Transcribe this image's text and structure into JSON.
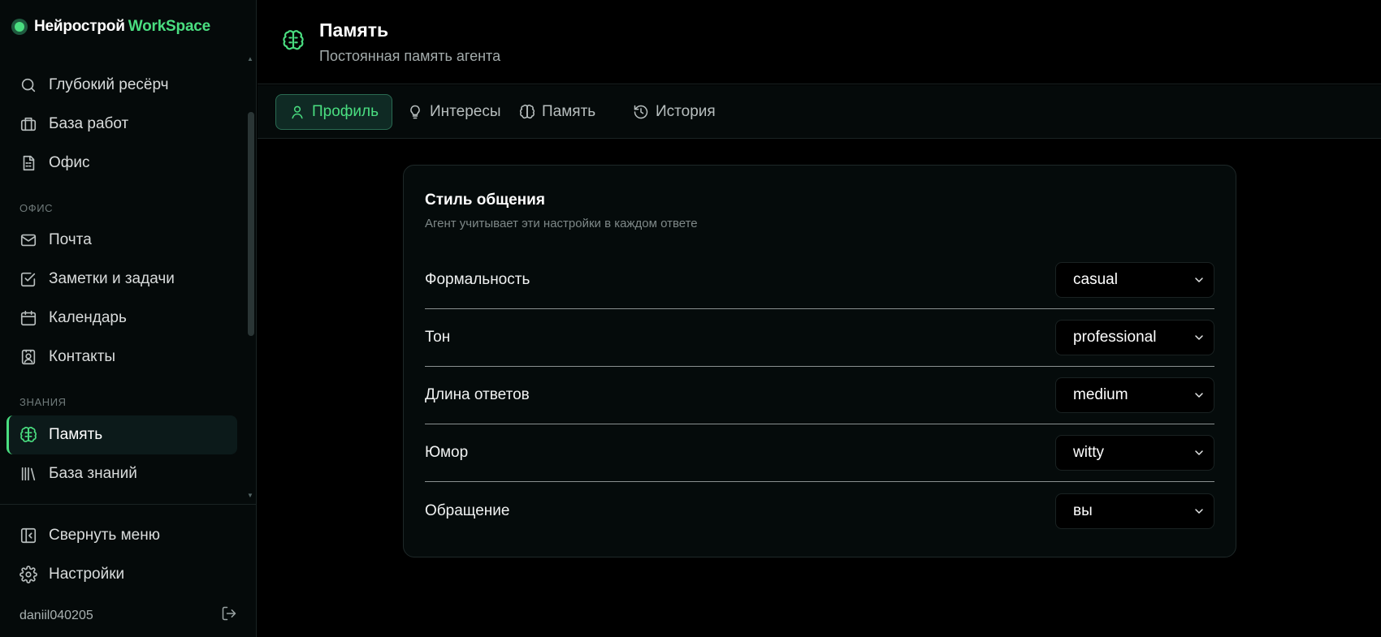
{
  "brand": {
    "name_part1": "Нейрострой",
    "name_part2": "WorkSpace",
    "accent": "#4ade80"
  },
  "sidebar": {
    "items_top": [
      {
        "label": "Глубокий ресёрч",
        "icon": "search-icon"
      },
      {
        "label": "База работ",
        "icon": "briefcase-icon"
      },
      {
        "label": "Офис",
        "icon": "document-icon"
      }
    ],
    "section_office": "ОФИС",
    "items_office": [
      {
        "label": "Почта",
        "icon": "mail-icon"
      },
      {
        "label": "Заметки и задачи",
        "icon": "checkbox-icon"
      },
      {
        "label": "Календарь",
        "icon": "calendar-icon"
      },
      {
        "label": "Контакты",
        "icon": "contact-icon"
      }
    ],
    "section_knowledge": "ЗНАНИЯ",
    "items_knowledge": [
      {
        "label": "Память",
        "icon": "brain-icon",
        "active": true
      },
      {
        "label": "База знаний",
        "icon": "library-icon"
      }
    ],
    "collapse_label": "Свернуть меню",
    "settings_label": "Настройки",
    "username": "daniil040205"
  },
  "header": {
    "title": "Память",
    "subtitle": "Постоянная память агента",
    "icon": "brain-icon"
  },
  "tabs": [
    {
      "label": "Профиль",
      "icon": "user-icon",
      "active": true
    },
    {
      "label": "Интересы",
      "icon": "lightbulb-icon"
    },
    {
      "label": "Память",
      "icon": "brain-icon"
    },
    {
      "label": "История",
      "icon": "history-icon"
    }
  ],
  "card": {
    "title": "Стиль общения",
    "subtitle": "Агент учитывает эти настройки в каждом ответе",
    "rows": [
      {
        "label": "Формальность",
        "value": "casual"
      },
      {
        "label": "Тон",
        "value": "professional"
      },
      {
        "label": "Длина ответов",
        "value": "medium"
      },
      {
        "label": "Юмор",
        "value": "witty"
      },
      {
        "label": "Обращение",
        "value": "вы"
      }
    ]
  }
}
